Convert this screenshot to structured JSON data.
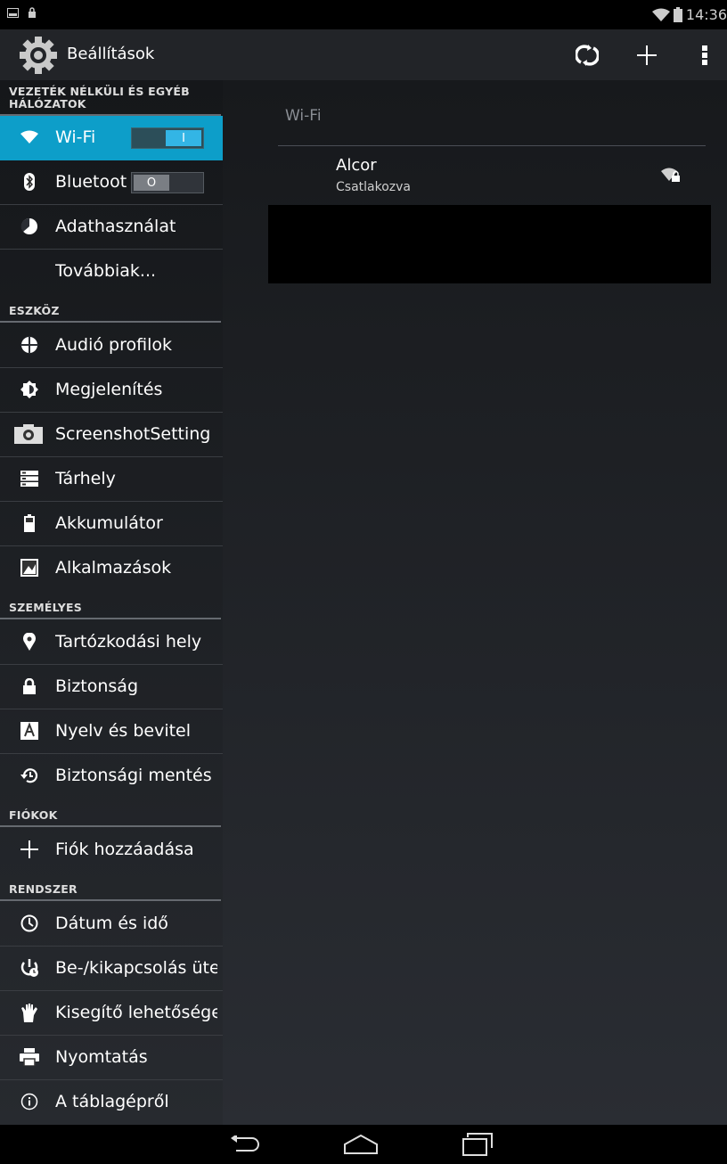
{
  "status_bar": {
    "time": "14:36",
    "icons": [
      "screenshot-icon",
      "lock-icon",
      "wifi-icon",
      "battery-icon"
    ]
  },
  "action_bar": {
    "title": "Beállítások",
    "buttons": [
      "wifi-wps-icon",
      "add-icon",
      "overflow-menu-icon"
    ]
  },
  "sidebar": {
    "sections": [
      {
        "header": "VEZETÉK NÉLKÜLI ÉS EGYÉB HÁLÓZATOK",
        "items": [
          {
            "label": "Wi-Fi",
            "icon": "wifi-icon",
            "selected": true,
            "toggle": "on"
          },
          {
            "label": "Bluetooth",
            "icon": "bluetooth-icon",
            "toggle": "off"
          },
          {
            "label": "Adathasználat",
            "icon": "data-usage-icon"
          },
          {
            "label": "Továbbiak...",
            "icon": ""
          }
        ]
      },
      {
        "header": "ESZKÖZ",
        "items": [
          {
            "label": "Audió profilok",
            "icon": "audio-profile-icon"
          },
          {
            "label": "Megjelenítés",
            "icon": "display-icon"
          },
          {
            "label": "ScreenshotSetting",
            "icon": "camera-icon"
          },
          {
            "label": "Tárhely",
            "icon": "storage-icon"
          },
          {
            "label": "Akkumulátor",
            "icon": "battery-icon"
          },
          {
            "label": "Alkalmazások",
            "icon": "apps-icon"
          }
        ]
      },
      {
        "header": "SZEMÉLYES",
        "items": [
          {
            "label": "Tartózkodási hely",
            "icon": "location-icon"
          },
          {
            "label": "Biztonság",
            "icon": "lock-icon"
          },
          {
            "label": "Nyelv és bevitel",
            "icon": "language-icon"
          },
          {
            "label": "Biztonsági mentés és visszaállítás",
            "icon": "backup-icon"
          }
        ]
      },
      {
        "header": "FIÓKOK",
        "items": [
          {
            "label": "Fiók hozzáadása",
            "icon": "add-icon"
          }
        ]
      },
      {
        "header": "RENDSZER",
        "items": [
          {
            "label": "Dátum és idő",
            "icon": "clock-icon"
          },
          {
            "label": "Be-/kikapcsolás ütemezése",
            "icon": "power-schedule-icon"
          },
          {
            "label": "Kisegítő lehetőségek",
            "icon": "accessibility-icon"
          },
          {
            "label": "Nyomtatás",
            "icon": "print-icon"
          },
          {
            "label": "A táblagépről",
            "icon": "info-icon"
          }
        ]
      }
    ]
  },
  "detail": {
    "title": "Wi-Fi",
    "networks": [
      {
        "name": "Alcor",
        "status": "Csatlakozva",
        "icon": "wifi-lock-icon"
      }
    ]
  },
  "nav_bar": {
    "buttons": [
      "back-icon",
      "home-icon",
      "recent-apps-icon"
    ]
  },
  "colors": {
    "accent": "#33b5e5",
    "selected_bg": "#0d9ec9"
  }
}
